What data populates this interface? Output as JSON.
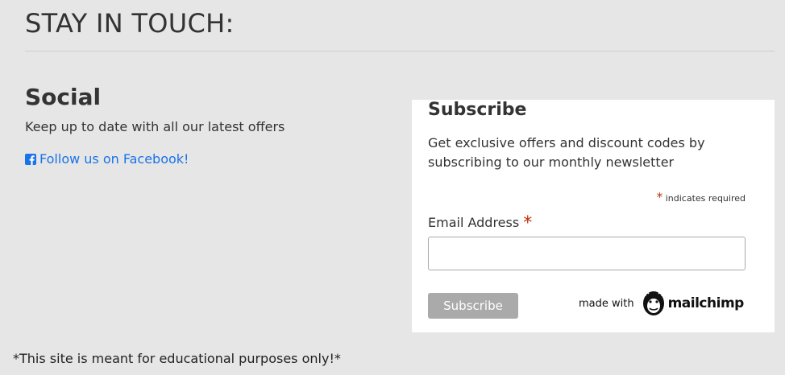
{
  "header": {
    "title": "STAY IN TOUCH:"
  },
  "social": {
    "title": "Social",
    "description": "Keep up to date with all our latest offers",
    "facebook_link": "Follow us on Facebook!",
    "icon": "facebook-square-icon"
  },
  "subscribe": {
    "title": "Subscribe",
    "description": "Get exclusive offers and discount codes by subscribing to our monthly newsletter",
    "required_marker": "*",
    "required_note": "indicates required",
    "email_label": "Email Address",
    "email_value": "",
    "button_label": "Subscribe",
    "made_with": "made with",
    "brand": "mailchimp"
  },
  "footer": {
    "disclaimer": "*This site is meant for educational purposes only!*"
  },
  "colors": {
    "background": "#e6e6e6",
    "link": "#1a73e8",
    "required": "#c02b0a",
    "button": "#aaaaaa"
  }
}
